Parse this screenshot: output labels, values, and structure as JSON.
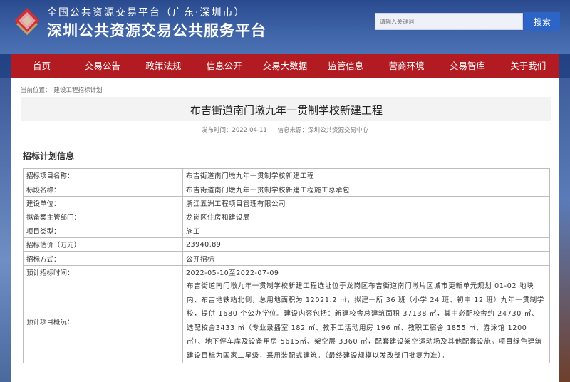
{
  "header": {
    "subtitle": "全国公共资源交易平台（广东·深圳市）",
    "title": "深圳公共资源交易公共服务平台",
    "search_placeholder": "请输入关键词",
    "search_button": "搜索",
    "logo_icon": "diamond-logo-icon"
  },
  "nav": {
    "items": [
      {
        "label": "首页"
      },
      {
        "label": "交易公告"
      },
      {
        "label": "政策法规"
      },
      {
        "label": "信息公开"
      },
      {
        "label": "交易大数据"
      },
      {
        "label": "监管信息"
      },
      {
        "label": "营商环境"
      },
      {
        "label": "交易智库"
      },
      {
        "label": "关于我们"
      }
    ]
  },
  "breadcrumb": {
    "prefix": "当前位置：",
    "current": "建设工程招标计划"
  },
  "article": {
    "title": "布吉街道南门墩九年一贯制学校新建工程",
    "publish_time": "发布时间：2022-04-11",
    "source": "信息来源：深圳公共资源交易中心"
  },
  "section": {
    "title": "招标计划信息"
  },
  "table": {
    "rows": [
      {
        "key": "招标项目名称：",
        "value": "布吉街道南门墩九年一贯制学校新建工程"
      },
      {
        "key": "标段名称：",
        "value": "布吉街道南门墩九年一贯制学校新建工程施工总承包"
      },
      {
        "key": "建设单位：",
        "value": "浙江五洲工程项目管理有限公司"
      },
      {
        "key": "拟备案主管部门：",
        "value": "龙岗区住房和建设局"
      },
      {
        "key": "项目类型：",
        "value": "施工"
      },
      {
        "key": "招标估价（万元）",
        "value": "23940.89"
      },
      {
        "key": "招标方式：",
        "value": "公开招标"
      },
      {
        "key": "预计招标时间：",
        "value": "2022-05-10至2022-07-09"
      },
      {
        "key": "预计项目概况：",
        "value": "布吉街道南门墩九年一贯制学校新建工程选址位于龙岗区布吉街道南门墩片区城市更新单元规划 01-02 地块内、布吉地铁站北侧，总用地面积为 12021.2 ㎡，拟建一所 36 班（小学 24 班、初中 12 班）九年一贯制学校，提供 1680 个公办学位。建设内容包括：新建校舍总建筑面积 37138 ㎡，其中必配校舍约 24730 ㎡、选配校舍3433 ㎡（专业录播室 182 ㎡、教职工活动用房 196 ㎡、教职工宿舍 1855 ㎡、游泳馆 1200 ㎡）、地下停车库及设备用房 5615㎡、架空层 3360 ㎡，配套建设架空运动场及其他配套设施。项目绿色建筑建设目标为国家二星级，采用装配式建筑。（最终建设规模以发改部门批复为准）。"
      }
    ]
  }
}
